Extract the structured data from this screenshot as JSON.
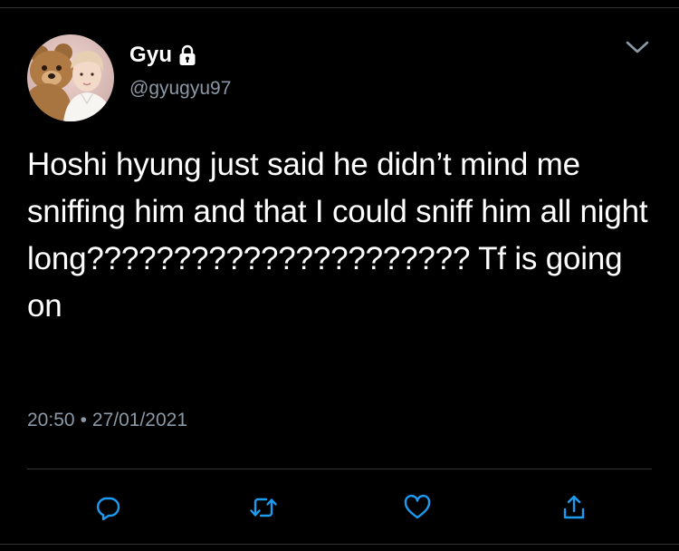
{
  "tweet": {
    "display_name": "Gyu",
    "handle": "@gyugyu97",
    "text": "Hoshi hyung just said he didn’t mind me sniffing him and that I could sniff him all night long?????????????????????? Tf is going on",
    "time": "20:50",
    "separator": "•",
    "date": "27/01/2021"
  },
  "icons": {
    "lock": "lock-icon",
    "chevron": "chevron-down-icon",
    "reply": "reply-icon",
    "retweet": "retweet-icon",
    "like": "heart-icon",
    "share": "share-icon"
  },
  "colors": {
    "background": "#000000",
    "text": "#ffffff",
    "secondary_text": "#8b98a5",
    "divider": "#2f3336",
    "action_icon": "#1d9bf0"
  }
}
